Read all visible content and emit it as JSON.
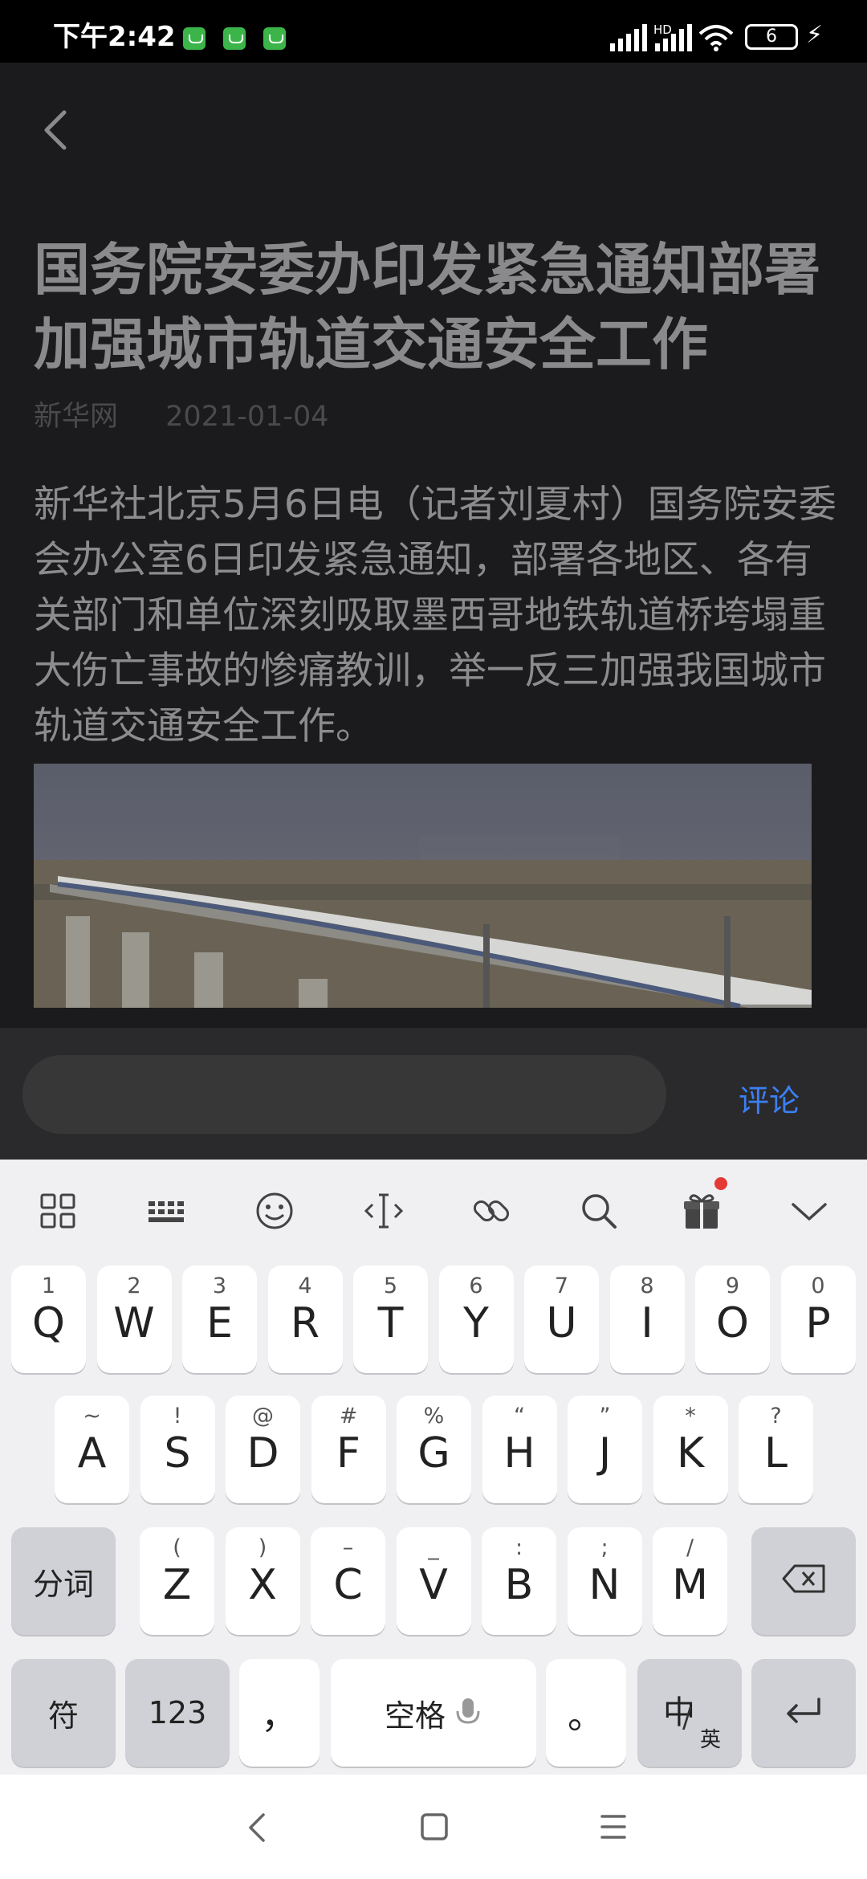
{
  "status_bar": {
    "time": "下午2:42",
    "network": "HD",
    "battery": "6"
  },
  "article": {
    "title": "国务院安委办印发紧急通知部署加强城市轨道交通安全工作",
    "source": "新华网",
    "date": "2021-01-04",
    "body": "新华社北京5月6日电（记者刘夏村）国务院安委会办公室6日印发紧急通知，部署各地区、各有关部门和单位深刻吸取墨西哥地铁轨道桥垮塌重大伤亡事故的惨痛教训，举一反三加强我国城市轨道交通安全工作。"
  },
  "comment": {
    "placeholder": "",
    "button_label": "评论"
  },
  "keyboard": {
    "toolbar": [
      "grid-menu-icon",
      "keyboard-icon",
      "emoji-icon",
      "text-cursor-icon",
      "link-icon",
      "search-icon",
      "gift-icon",
      "collapse-icon"
    ],
    "row1": [
      [
        "Q",
        "1"
      ],
      [
        "W",
        "2"
      ],
      [
        "E",
        "3"
      ],
      [
        "R",
        "4"
      ],
      [
        "T",
        "5"
      ],
      [
        "Y",
        "6"
      ],
      [
        "U",
        "7"
      ],
      [
        "I",
        "8"
      ],
      [
        "O",
        "9"
      ],
      [
        "P",
        "0"
      ]
    ],
    "row2": [
      [
        "A",
        "~"
      ],
      [
        "S",
        "!"
      ],
      [
        "D",
        "@"
      ],
      [
        "F",
        "#"
      ],
      [
        "G",
        "%"
      ],
      [
        "H",
        "“"
      ],
      [
        "J",
        "”"
      ],
      [
        "K",
        "*"
      ],
      [
        "L",
        "?"
      ]
    ],
    "row3": [
      [
        "Z",
        "("
      ],
      [
        "X",
        ")"
      ],
      [
        "C",
        "–"
      ],
      [
        "V",
        "_"
      ],
      [
        "B",
        ":"
      ],
      [
        "N",
        ";"
      ],
      [
        "M",
        "/"
      ]
    ],
    "fenci": "分词",
    "symbols": "符",
    "numbers": "123",
    "comma": "，",
    "space": "空格",
    "period": "。",
    "lang_main": "中",
    "lang_sub": "英",
    "accent": "#3b7ff5"
  }
}
